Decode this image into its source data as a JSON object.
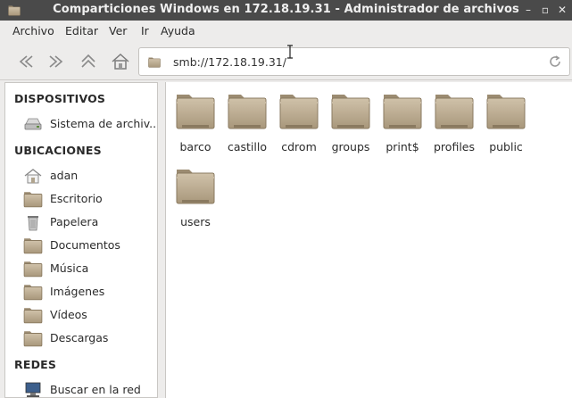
{
  "window": {
    "title": "Comparticiones Windows en 172.18.19.31 - Administrador de archivos"
  },
  "menubar": {
    "items": [
      "Archivo",
      "Editar",
      "Ver",
      "Ir",
      "Ayuda"
    ]
  },
  "toolbar": {
    "location": "smb://172.18.19.31/"
  },
  "sidebar": {
    "devices_title": "DISPOSITIVOS",
    "devices": [
      {
        "label": "Sistema de archiv...",
        "icon": "drive-icon"
      }
    ],
    "places_title": "UBICACIONES",
    "places": [
      {
        "label": "adan",
        "icon": "home-icon"
      },
      {
        "label": "Escritorio",
        "icon": "desktop-folder-icon"
      },
      {
        "label": "Papelera",
        "icon": "trash-icon"
      },
      {
        "label": "Documentos",
        "icon": "documents-folder-icon"
      },
      {
        "label": "Música",
        "icon": "music-folder-icon"
      },
      {
        "label": "Imágenes",
        "icon": "pictures-folder-icon"
      },
      {
        "label": "Vídeos",
        "icon": "videos-folder-icon"
      },
      {
        "label": "Descargas",
        "icon": "downloads-folder-icon"
      }
    ],
    "network_title": "REDES",
    "network": [
      {
        "label": "Buscar en la red",
        "icon": "network-icon"
      }
    ]
  },
  "files": [
    {
      "name": "barco"
    },
    {
      "name": "castillo"
    },
    {
      "name": "cdrom"
    },
    {
      "name": "groups"
    },
    {
      "name": "print$"
    },
    {
      "name": "profiles"
    },
    {
      "name": "public"
    },
    {
      "name": "users"
    }
  ],
  "colors": {
    "titlebar": "#4a4a4a",
    "folder": "#b8a88e",
    "folder_dark": "#8f8069"
  }
}
